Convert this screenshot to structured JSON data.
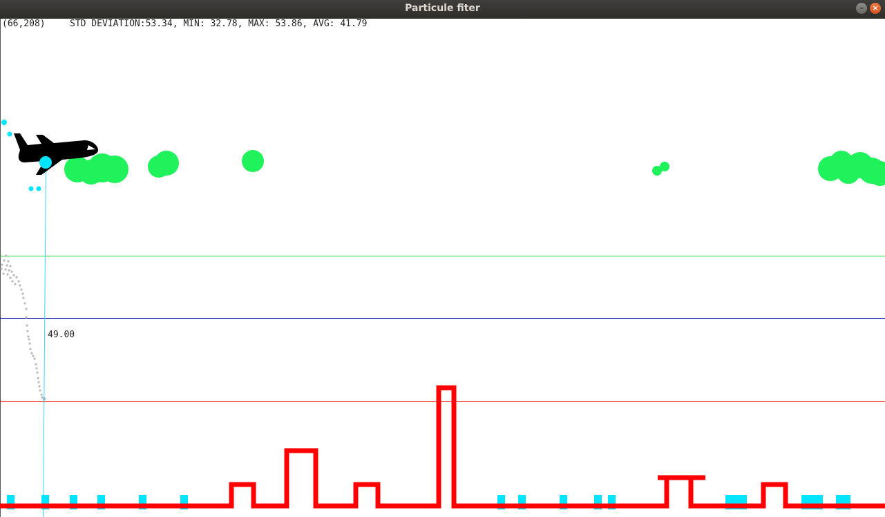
{
  "window": {
    "title": "Particule fiter",
    "minimize_glyph": "–",
    "close_glyph": "×"
  },
  "readout": {
    "coords": "(66,208)",
    "stats": "STD DEVIATION:53.34, MIN: 32.78, MAX: 53.86, AVG: 41.79"
  },
  "measurement": {
    "label": "49.00"
  },
  "colors": {
    "plane": "#000000",
    "particles": "#00e5ff",
    "clouds": "#1ff25a",
    "histogram": "#ff0000",
    "trail": "#b9b9b9",
    "line_green": "#1fe03a",
    "line_blue": "#0000aa",
    "line_red": "#ff0000"
  },
  "icons": [
    "airplane-icon",
    "minimize-icon",
    "close-icon"
  ]
}
